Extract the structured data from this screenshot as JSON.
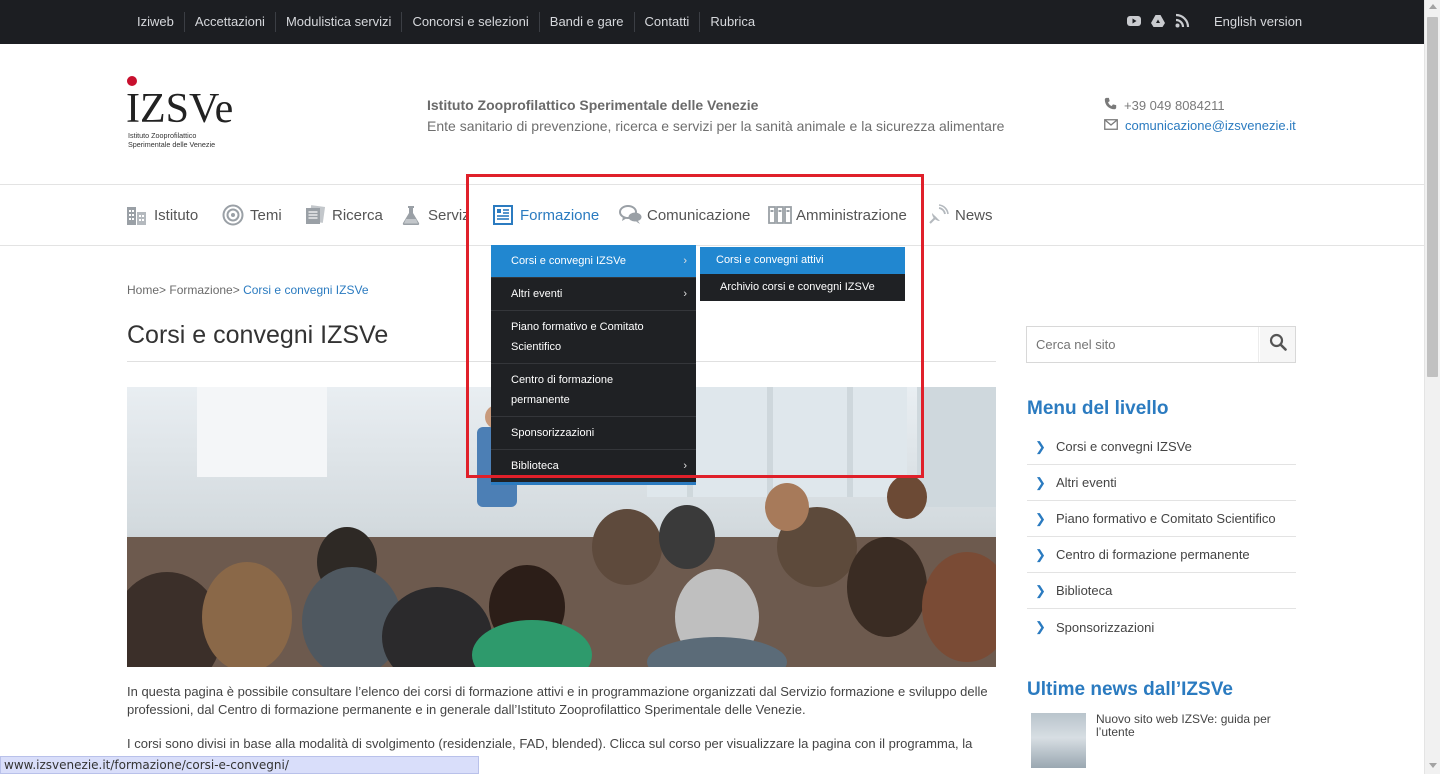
{
  "topbar": {
    "links": [
      "Iziweb",
      "Accettazioni",
      "Modulistica servizi",
      "Concorsi e selezioni",
      "Bandi e gare",
      "Contatti",
      "Rubrica"
    ],
    "social_icons": [
      "youtube-icon",
      "google-drive-icon",
      "rss-icon"
    ],
    "english": "English version"
  },
  "header": {
    "logo_text": "IZSVe",
    "logo_sub1": "Istituto Zooprofilattico",
    "logo_sub2": "Sperimentale delle Venezie",
    "name": "Istituto Zooprofilattico Sperimentale delle Venezie",
    "subtitle": "Ente sanitario di prevenzione, ricerca e servizi per la sanità animale e la sicurezza alimentare",
    "phone": "+39 049 8084211",
    "email": "comunicazione@izsvenezie.it"
  },
  "nav": {
    "items": [
      {
        "label": "Istituto",
        "icon": "building-icon"
      },
      {
        "label": "Temi",
        "icon": "target-icon"
      },
      {
        "label": "Ricerca",
        "icon": "documents-icon"
      },
      {
        "label": "Servizi",
        "icon": "flask-icon"
      },
      {
        "label": "Formazione",
        "icon": "book-icon"
      },
      {
        "label": "Comunicazione",
        "icon": "chat-icon"
      },
      {
        "label": "Amministrazione",
        "icon": "binders-icon"
      },
      {
        "label": "News",
        "icon": "satellite-icon"
      }
    ],
    "active": "Formazione"
  },
  "dropdown": {
    "items": [
      {
        "label": "Corsi e convegni IZSVe",
        "has_sub": true
      },
      {
        "label": "Altri eventi",
        "has_sub": true
      },
      {
        "label": "Piano formativo e Comitato Scientifico",
        "has_sub": false
      },
      {
        "label": "Centro di formazione permanente",
        "has_sub": false
      },
      {
        "label": "Sponsorizzazioni",
        "has_sub": false
      },
      {
        "label": "Biblioteca",
        "has_sub": true
      }
    ],
    "submenu": [
      "Corsi e convegni attivi",
      "Archivio corsi e convegni IZSVe"
    ],
    "chevron": "›"
  },
  "breadcrumb": {
    "home": "Home",
    "sep": ">",
    "parent": "Formazione",
    "current": "Corsi e convegni IZSVe"
  },
  "main": {
    "title": "Corsi e convegni IZSVe",
    "p1": "In questa pagina è possibile consultare l’elenco dei corsi di formazione attivi e in programmazione organizzati dal Servizio formazione e sviluppo delle professioni, dal Centro di formazione permanente e in generale dall’Istituto Zooprofilattico Sperimentale delle Venezie.",
    "p2": "I corsi sono divisi in base alla modalità di svolgimento (residenziale, FAD, blended). Clicca sul corso per visualizzare la pagina con il programma, la"
  },
  "sidebar": {
    "search_placeholder": "Cerca nel sito",
    "menu_title": "Menu del livello",
    "menu_items": [
      "Corsi e convegni IZSVe",
      "Altri eventi",
      "Piano formativo e Comitato Scientifico",
      "Centro di formazione permanente",
      "Biblioteca",
      "Sponsorizzazioni"
    ],
    "news_title": "Ultime news dall’IZSVe",
    "news_item": "Nuovo sito web IZSVe: guida per l’utente"
  },
  "statusbar": {
    "url": "www.izsvenezie.it/formazione/corsi-e-convegni/"
  },
  "colors": {
    "accent": "#2b7bc0",
    "topbar": "#1c1e22",
    "dropdown_bg": "#1f2124",
    "dropdown_highlight": "#2187d0",
    "annotation_box": "#e0202a"
  }
}
